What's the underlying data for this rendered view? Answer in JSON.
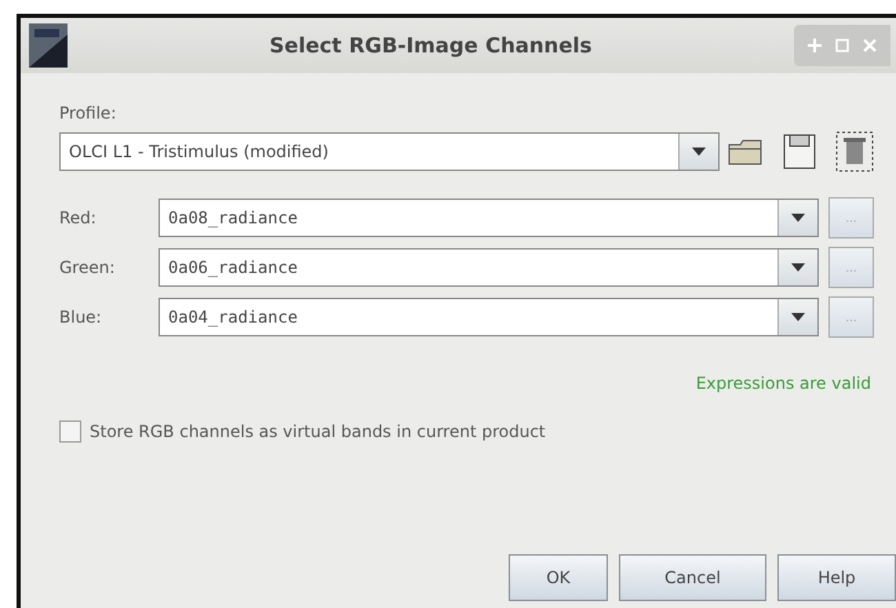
{
  "window": {
    "title": "Select RGB-Image Channels"
  },
  "profile": {
    "label": "Profile:",
    "value": "OLCI L1 - Tristimulus (modified)"
  },
  "channels": [
    {
      "label": "Red:",
      "value": "0a08_radiance",
      "button": "..."
    },
    {
      "label": "Green:",
      "value": "0a06_radiance",
      "button": "..."
    },
    {
      "label": "Blue:",
      "value": "0a04_radiance",
      "button": "..."
    }
  ],
  "status": "Expressions are valid",
  "store_option": {
    "label": "Store RGB channels as virtual bands in current product",
    "checked": false
  },
  "buttons": [
    "OK",
    "Cancel",
    "Help"
  ]
}
